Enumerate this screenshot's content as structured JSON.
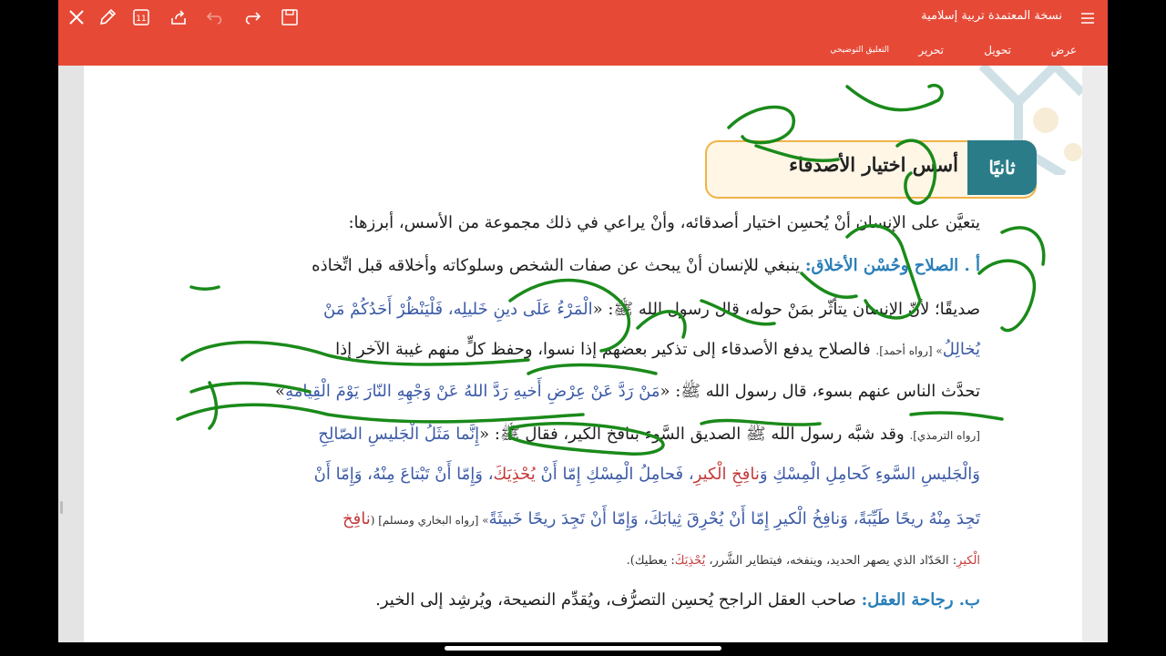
{
  "app": {
    "doc_title": "نسخة المعتمدة تربية إسلامية",
    "menu_tabs": [
      "عرض",
      "تحويل",
      "تحرير",
      "التعليق التوضيحي"
    ],
    "toolbar_icons": [
      "close-icon",
      "pen-icon",
      "page-count-icon",
      "share-icon",
      "undo-icon",
      "redo-icon",
      "save-icon",
      "menu-icon"
    ],
    "page_count": "11",
    "accent": "#e64a37"
  },
  "section": {
    "tag": "ثانيًا",
    "title": "أسس اختيار الأصدقاء"
  },
  "lines": {
    "l1": "يتعيَّن على الإنسان أنْ يُحسِن اختيار أصدقائه، وأنْ يراعي في ذلك مجموعة من الأسس، أبرزها:",
    "l2_sub": "أ . الصلاح وحُسْن الأخلاق:",
    "l2": " ينبغي للإنسان أنْ يبحث عن صفات الشخص وسلوكاته وأخلاقه قبل اتِّخاذه",
    "l3": "صديقًا؛ لأنّ الإنسان يتأثّر بمَنْ حوله، قال رسول الله ﷺ: «",
    "l3_quote": "الْمَرْءُ عَلَى دينِ خَليلِه، فَلْيَنْظُرْ أَحَدُكُمْ مَنْ",
    "l4_quote": "يُخالِلُ",
    "l4_ref": "» [رواه أحمد].",
    "l4": " فالصلاح يدفع الأصدقاء إلى تذكير بعضهم إذا نسوا، وحفظ كلٍّ منهم غيبة الآخر إذا",
    "l5": "تحدَّث الناس عنهم بسوء، قال رسول الله ﷺ: «",
    "l5_quote": "مَنْ رَدَّ عَنْ عِرْضِ أَخيهِ رَدَّ اللهُ عَنْ وَجْهِهِ النّارَ يَوْمَ الْقِيامَةِ",
    "l5_end": "»",
    "l6_ref": "[رواه الترمذي].",
    "l6": " وقد شبَّه رسول الله ﷺ الصديق السَّوء بنافخ الكير، فقال ﷺ: «",
    "l6_quote": "إِنَّما مَثَلُ الْجَليسِ الصّالِحِ",
    "l7_a": "وَالْجَليسِ السَّوءِ كَحامِلِ الْمِسْكِ وَ",
    "l7_red1": "نافِخِ الْكيرِ",
    "l7_b": "، فَحامِلُ الْمِسْكِ إِمّا أَنْ ",
    "l7_red2": "يُحْذِيَكَ",
    "l7_c": "، وَإِمّا أَنْ تَبْتاعَ مِنْهُ، وَإِمّا أَنْ",
    "l8": "تَجِدَ مِنْهُ ريحًا طَيِّبَةً، وَنافِخُ الْكيرِ إِمّا أَنْ يُحْرِقَ ثِيابَكَ، وَإِمّا أَنْ تَجِدَ ريحًا خَبيثَةً",
    "l8_ref": "» [رواه البخاري ومسلم] (",
    "l8_red": "نافِخ",
    "l9_red": "الْكيرِ",
    "l9": ": الحَدّاد الذي يصهر الحديد، وينفخه، فيتطاير الشَّرر، ",
    "l9_red2": "يُحْذِيَكَ",
    "l9_end": ": يعطيك).",
    "l10_sub": "ب. رجاحة العقل:",
    "l10": " صاحب العقل الراجح يُحسِن التصرُّف، ويُقدِّم النصيحة، ويُرشِد إلى الخير."
  }
}
